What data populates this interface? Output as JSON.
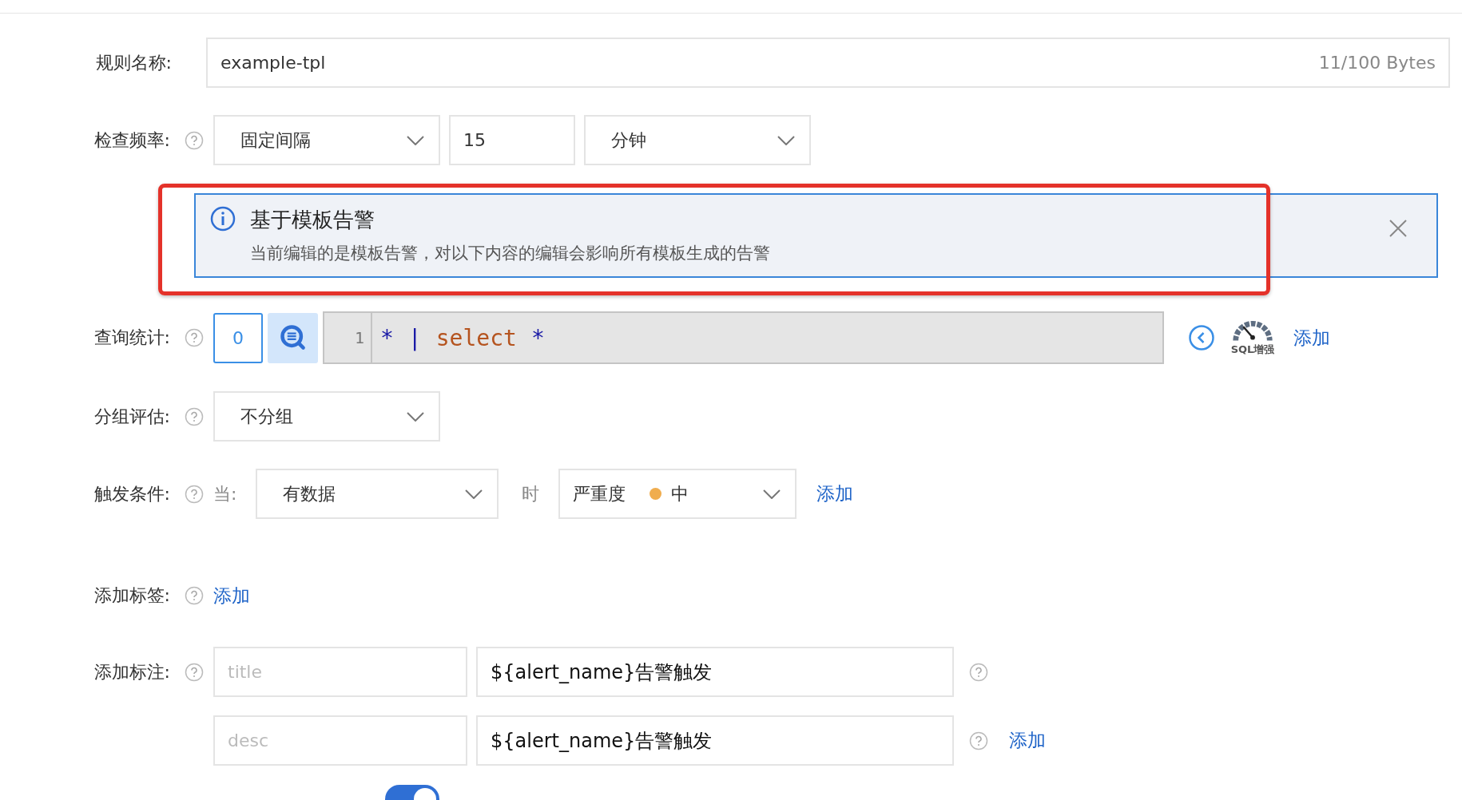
{
  "rule_name": {
    "label": "规则名称:",
    "value": "example-tpl",
    "counter": "11/100 Bytes"
  },
  "check_frequency": {
    "label": "检查频率:",
    "mode": "固定间隔",
    "interval": "15",
    "unit": "分钟"
  },
  "alert_notice": {
    "title": "基于模板告警",
    "message": "当前编辑的是模板告警，对以下内容的编辑会影响所有模板生成的告警",
    "highlighted": true
  },
  "query": {
    "label": "查询统计:",
    "count": "0",
    "line_number": "1",
    "code": [
      {
        "text": "*",
        "kind": "operator"
      },
      {
        "text": "|",
        "kind": "operator"
      },
      {
        "text": "select",
        "kind": "keyword"
      },
      {
        "text": "*",
        "kind": "operator"
      }
    ],
    "enhance_label": "SQL增强",
    "add": "添加"
  },
  "grouping": {
    "label": "分组评估:",
    "value": "不分组"
  },
  "trigger": {
    "label": "触发条件:",
    "when": "当:",
    "condition": "有数据",
    "then": "时",
    "severity_label": "严重度",
    "severity": {
      "label": "中",
      "color": "#f0ad4e"
    },
    "add": "添加"
  },
  "labels": {
    "label": "添加标签:",
    "add": "添加"
  },
  "annotations": {
    "label": "添加标注:",
    "rows": [
      {
        "key_placeholder": "title",
        "value": "${alert_name}告警触发",
        "add": null
      },
      {
        "key_placeholder": "desc",
        "value": "${alert_name}告警触发",
        "add": "添加"
      }
    ]
  },
  "toggle": {
    "on": true
  }
}
